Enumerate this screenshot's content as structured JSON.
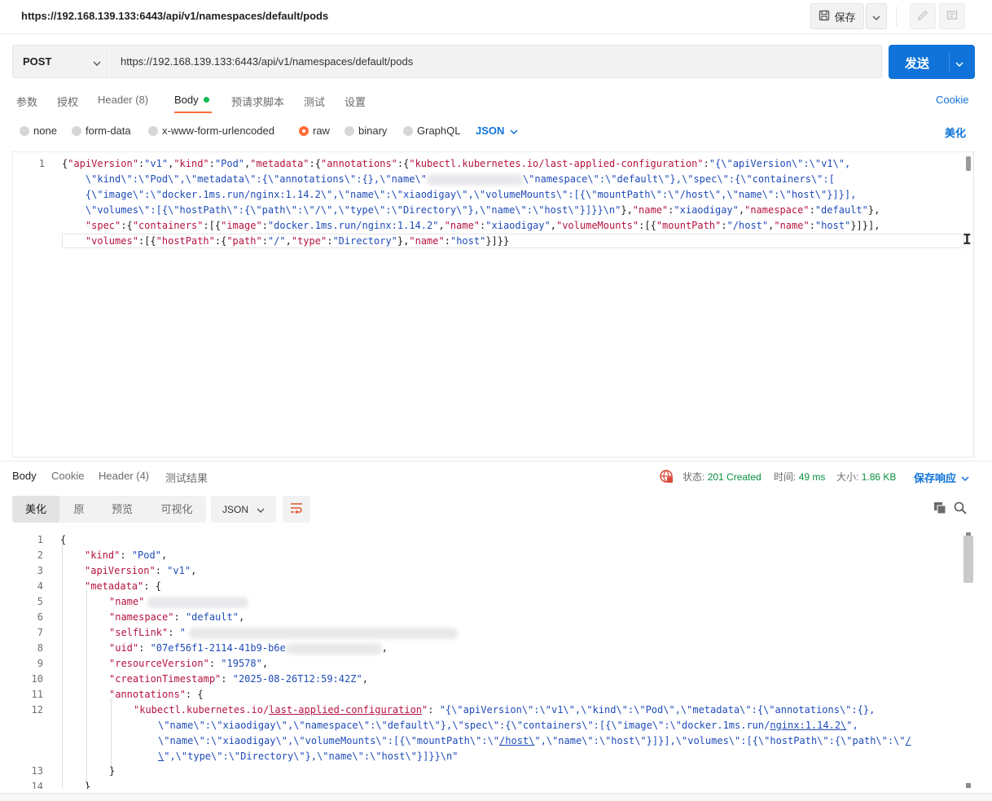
{
  "title": {
    "url": "https://192.168.139.133:6443/api/v1/namespaces/default/pods",
    "save_label": "保存"
  },
  "request": {
    "method": "POST",
    "url": "https://192.168.139.133:6443/api/v1/namespaces/default/pods",
    "send_label": "发送"
  },
  "request_tabs": {
    "params": "参数",
    "auth": "授权",
    "headers": "Header (8)",
    "body": "Body",
    "prerequest": "预请求脚本",
    "tests": "测试",
    "settings": "设置",
    "cookie": "Cookie"
  },
  "body_types": {
    "none": "none",
    "form_data": "form-data",
    "urlencoded": "x-www-form-urlencoded",
    "raw": "raw",
    "binary": "binary",
    "graphql": "GraphQL",
    "language": "JSON",
    "beautify": "美化"
  },
  "request_body": {
    "line_number": "1"
  },
  "response_tabs": {
    "body": "Body",
    "cookie": "Cookie",
    "headers": "Header (4)",
    "tests": "测试结果"
  },
  "response_status": {
    "status_label": "状态:",
    "status_value": "201 Created",
    "time_label": "时间:",
    "time_value": "49 ms",
    "size_label": "大小:",
    "size_value": "1.86 KB",
    "save_response": "保存响应"
  },
  "response_view": {
    "pretty": "美化",
    "raw": "原",
    "preview": "预览",
    "visualize": "可视化",
    "language": "JSON"
  },
  "response_body": {
    "line_numbers": [
      "1",
      "2",
      "3",
      "4",
      "5",
      "6",
      "7",
      "8",
      "9",
      "10",
      "11",
      "12",
      "13",
      "14"
    ]
  },
  "colors": {
    "accent": "#0f73d9",
    "tab_indicator": "#ff6c37",
    "body_dot": "#0cbb52",
    "json_key": "#b5123e",
    "json_string": "#1e4bb8"
  },
  "icons": [
    "save-icon",
    "chevron-down-icon",
    "edit-icon",
    "comment-icon",
    "globe-icon",
    "copy-icon",
    "search-icon",
    "wrap-lines-icon"
  ]
}
